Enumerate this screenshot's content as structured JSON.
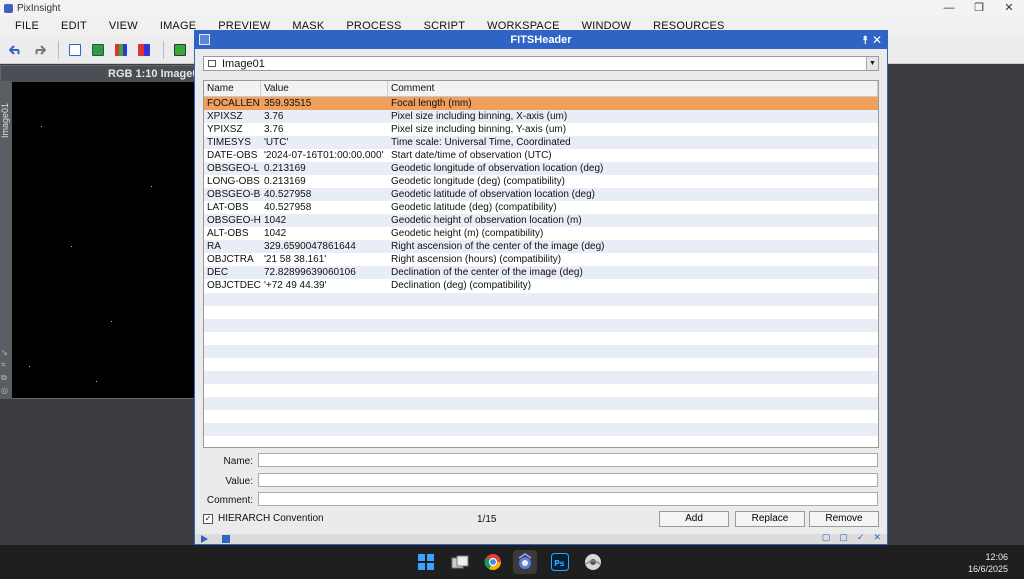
{
  "app": {
    "title": "PixInsight"
  },
  "window_controls": {
    "minimize": "—",
    "restore": "❐",
    "close": "✕"
  },
  "menu": [
    "FILE",
    "EDIT",
    "VIEW",
    "IMAGE",
    "PREVIEW",
    "MASK",
    "PROCESS",
    "SCRIPT",
    "WORKSPACE",
    "WINDOW",
    "RESOURCES"
  ],
  "image_window": {
    "title": "RGB 1:10 Image01",
    "side_label": "Image01"
  },
  "dialog": {
    "title": "FITSHeader",
    "selected_view": "Image01",
    "columns": [
      "Name",
      "Value",
      "Comment"
    ],
    "keywords": [
      {
        "name": "FOCALLEN",
        "value": "359.93515",
        "comment": "Focal length (mm)",
        "selected": true
      },
      {
        "name": "XPIXSZ",
        "value": "3.76",
        "comment": "Pixel size including binning, X-axis (um)"
      },
      {
        "name": "YPIXSZ",
        "value": "3.76",
        "comment": "Pixel size including binning, Y-axis (um)"
      },
      {
        "name": "TIMESYS",
        "value": "'UTC'",
        "comment": "Time scale: Universal Time, Coordinated"
      },
      {
        "name": "DATE-OBS",
        "value": "'2024-07-16T01:00:00.000'",
        "comment": "Start date/time of observation (UTC)"
      },
      {
        "name": "OBSGEO-L",
        "value": "0.213169",
        "comment": "Geodetic longitude of observation location (deg)"
      },
      {
        "name": "LONG-OBS",
        "value": "0.213169",
        "comment": "Geodetic longitude (deg) (compatibility)"
      },
      {
        "name": "OBSGEO-B",
        "value": "40.527958",
        "comment": "Geodetic latitude of observation location (deg)"
      },
      {
        "name": "LAT-OBS",
        "value": "40.527958",
        "comment": "Geodetic latitude (deg) (compatibility)"
      },
      {
        "name": "OBSGEO-H",
        "value": "1042",
        "comment": "Geodetic height of observation location (m)"
      },
      {
        "name": "ALT-OBS",
        "value": "1042",
        "comment": "Geodetic height (m) (compatibility)"
      },
      {
        "name": "RA",
        "value": "329.6590047861644",
        "comment": "Right ascension of the center of the image (deg)"
      },
      {
        "name": "OBJCTRA",
        "value": "'21 58 38.161'",
        "comment": "Right ascension (hours) (compatibility)"
      },
      {
        "name": "DEC",
        "value": "72.82899639060106",
        "comment": "Declination of the center of the image (deg)"
      },
      {
        "name": "OBJCTDEC",
        "value": "'+72 49 44.39'",
        "comment": "Declination (deg) (compatibility)"
      }
    ],
    "fields": {
      "name_label": "Name:",
      "value_label": "Value:",
      "comment_label": "Comment:",
      "name_value": "",
      "value_value": "",
      "comment_value": ""
    },
    "hierarch": {
      "label": "HIERARCH Convention",
      "checked": true,
      "check_glyph": "✓"
    },
    "counter": "1/15",
    "buttons": {
      "add": "Add",
      "replace": "Replace",
      "remove": "Remove"
    },
    "controls": {
      "pin": "⯭",
      "close": "✕"
    }
  },
  "taskbar": {
    "time": "12:06",
    "date": "16/6/2025"
  },
  "colors": {
    "accent": "#2f63c4",
    "selected_row": "#f0a05c",
    "alt_row": "#e8edf6"
  }
}
